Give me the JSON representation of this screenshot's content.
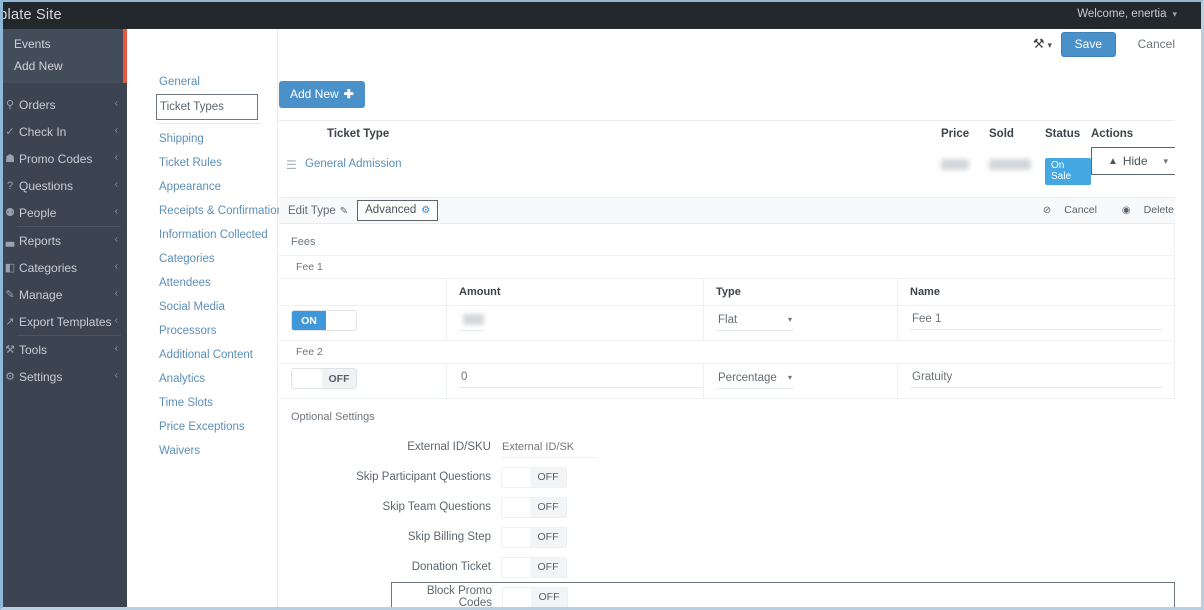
{
  "topbar": {
    "site_title": "mplate Site",
    "welcome": "Welcome, enertia",
    "caret": "▾"
  },
  "sidebar": {
    "top_items": [
      {
        "label": "Events"
      },
      {
        "label": "Add New"
      }
    ],
    "accent_color": "#e8573f",
    "bg_color": "#3b4450",
    "items": [
      {
        "label": "Orders",
        "icon": "cart-icon",
        "glyph": "⚲",
        "chevron": "‹"
      },
      {
        "label": "Check In",
        "icon": "check-icon",
        "glyph": "✓",
        "chevron": "‹"
      },
      {
        "label": "Promo Codes",
        "icon": "tag-icon",
        "glyph": "☗",
        "chevron": "‹"
      },
      {
        "label": "Questions",
        "icon": "question-icon",
        "glyph": "?",
        "chevron": "‹"
      },
      {
        "label": "People",
        "icon": "people-icon",
        "glyph": "⚉",
        "chevron": "‹"
      },
      {
        "label": "Reports",
        "icon": "bar-chart-icon",
        "glyph": "▃",
        "chevron": "‹"
      },
      {
        "label": "Categories",
        "icon": "folder-icon",
        "glyph": "◧",
        "chevron": "‹"
      },
      {
        "label": "Manage",
        "icon": "pencil-icon",
        "glyph": "✎",
        "chevron": "‹"
      },
      {
        "label": "Export Templates",
        "icon": "export-icon",
        "glyph": "↗",
        "chevron": "‹"
      },
      {
        "label": "Tools",
        "icon": "wrench-icon",
        "glyph": "⚒",
        "chevron": "‹"
      },
      {
        "label": "Settings",
        "icon": "gear-icon",
        "glyph": "⚙",
        "chevron": "‹"
      }
    ]
  },
  "settings_nav": {
    "items": [
      {
        "label": "General",
        "active": false
      },
      {
        "label": "Ticket Types",
        "active": true
      },
      {
        "label": "Shipping",
        "active": false
      },
      {
        "label": "Ticket Rules",
        "active": false
      },
      {
        "label": "Appearance",
        "active": false
      },
      {
        "label": "Receipts & Confirmations",
        "active": false
      },
      {
        "label": "Information Collected",
        "active": false
      },
      {
        "label": "Categories",
        "active": false
      },
      {
        "label": "Attendees",
        "active": false
      },
      {
        "label": "Social Media",
        "active": false
      },
      {
        "label": "Processors",
        "active": false
      },
      {
        "label": "Additional Content",
        "active": false
      },
      {
        "label": "Analytics",
        "active": false
      },
      {
        "label": "Time Slots",
        "active": false
      },
      {
        "label": "Price Exceptions",
        "active": false
      },
      {
        "label": "Waivers",
        "active": false
      }
    ]
  },
  "header_actions": {
    "wrench_icon": "wrench-icon",
    "wrench_glyph": "⚒",
    "wrench_caret": "▾",
    "save_label": "Save",
    "cancel_label": "Cancel",
    "save_color": "#4a90c9"
  },
  "toolbar": {
    "add_new_label": "Add New",
    "add_new_plus": "✚"
  },
  "ticket_table": {
    "columns": {
      "type": "Ticket Type",
      "price": "Price",
      "sold": "Sold",
      "status": "Status",
      "actions": "Actions"
    },
    "rows": [
      {
        "drag_handle": "☰",
        "type": "General Admission",
        "price": "",
        "sold": "",
        "status_badge": "On Sale",
        "status_color": "#45a8e0",
        "action_label": "Hide",
        "action_up_caret": "▲",
        "action_down_caret": "▾"
      }
    ]
  },
  "tabs": {
    "edit_type": {
      "label": "Edit Type",
      "icon": "edit-pencil-icon",
      "glyph": "✎",
      "active": false
    },
    "advanced": {
      "label": "Advanced",
      "icon": "gear-icon",
      "glyph": "⚙",
      "active": true
    },
    "cancel": {
      "label": "Cancel",
      "icon": "cancel-circle-icon",
      "glyph": "⊘"
    },
    "delete": {
      "label": "Delete",
      "icon": "delete-circle-icon",
      "glyph": "◉"
    }
  },
  "fees": {
    "section_label": "Fees",
    "columns": {
      "amount": "Amount",
      "type": "Type",
      "name": "Name"
    },
    "rows": [
      {
        "sub_label": "Fee 1",
        "toggle_state": "ON",
        "toggle_on": true,
        "amount_value": "",
        "amount_redacted": true,
        "type_value": "Flat",
        "type_caret": "▾",
        "name_value": "Fee 1"
      },
      {
        "sub_label": "Fee 2",
        "toggle_state": "OFF",
        "toggle_on": false,
        "amount_value": "0",
        "amount_redacted": false,
        "type_value": "Percentage",
        "type_caret": "▾",
        "name_value": "Gratuity"
      }
    ]
  },
  "optional_settings": {
    "section_label": "Optional Settings",
    "rows": [
      {
        "label": "External ID/SKU",
        "kind": "text",
        "value": "",
        "placeholder": "External ID/SK",
        "highlight": false
      },
      {
        "label": "Skip Participant Questions",
        "kind": "toggle",
        "state": "OFF",
        "highlight": false
      },
      {
        "label": "Skip Team Questions",
        "kind": "toggle",
        "state": "OFF",
        "highlight": false
      },
      {
        "label": "Skip Billing Step",
        "kind": "toggle",
        "state": "OFF",
        "highlight": false
      },
      {
        "label": "Donation Ticket",
        "kind": "toggle",
        "state": "OFF",
        "highlight": false
      },
      {
        "label": "Block Promo Codes",
        "kind": "toggle",
        "state": "OFF",
        "highlight": true
      }
    ]
  }
}
